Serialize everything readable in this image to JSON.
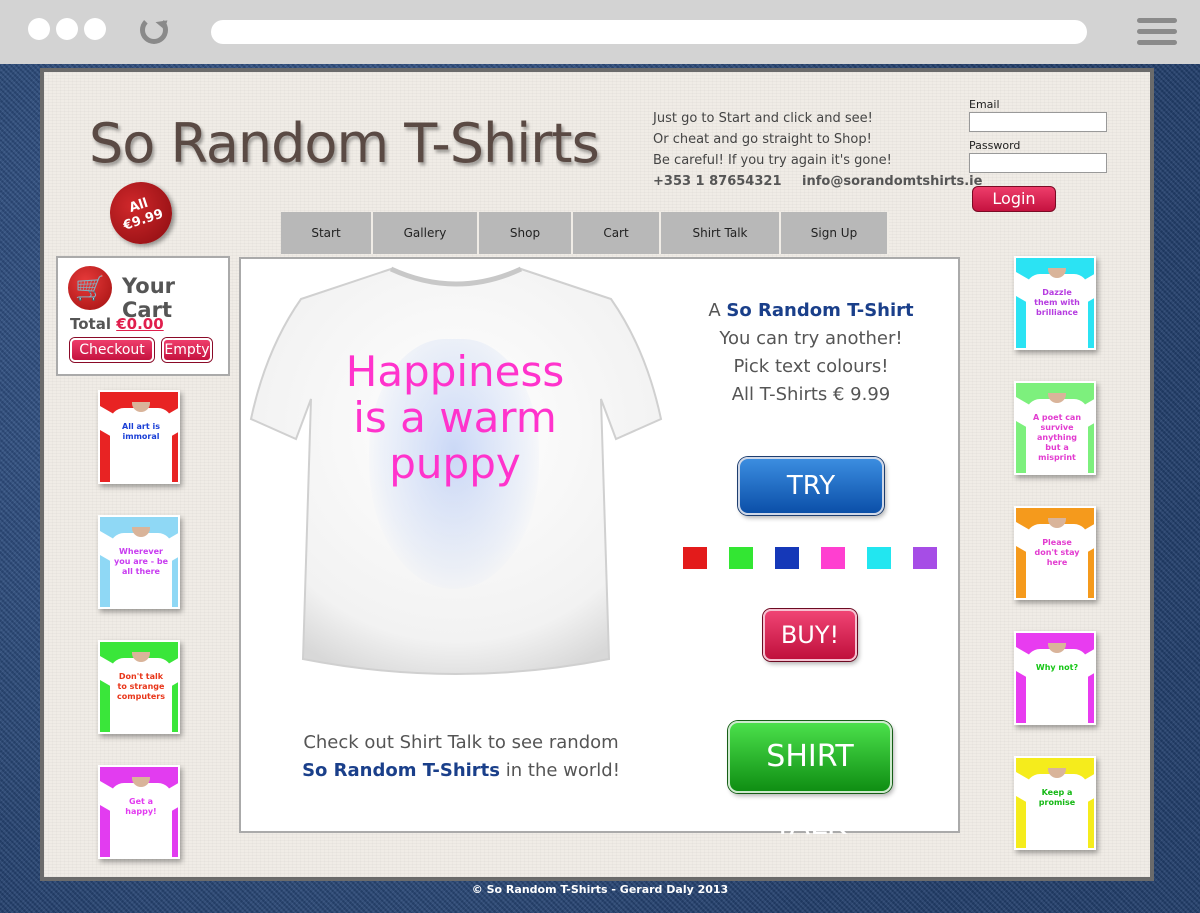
{
  "site": {
    "logo": "So Random T-Shirts",
    "seal_line1": "All",
    "seal_line2": "€9.99"
  },
  "tagline": {
    "line1": "Just go to Start and click and see!",
    "line2": "Or cheat and go straight to Shop!",
    "line3": "Be careful! If you try again it's gone!",
    "phone": "+353 1 87654321",
    "email": "info@sorandomtshirts.ie"
  },
  "login": {
    "email_label": "Email",
    "password_label": "Password",
    "email_value": "",
    "password_value": "",
    "button": "Login"
  },
  "nav": {
    "tabs": [
      {
        "label": "Start"
      },
      {
        "label": "Gallery"
      },
      {
        "label": "Shop"
      },
      {
        "label": "Cart"
      },
      {
        "label": "Shirt Talk"
      },
      {
        "label": "Sign Up"
      }
    ]
  },
  "cart": {
    "icon": "shopping-cart-icon",
    "title": "Your Cart",
    "total_label": "Total",
    "total_value": "€0.00",
    "checkout": "Checkout",
    "empty": "Empty"
  },
  "main": {
    "shirt_text_line1": "Happiness",
    "shirt_text_line2": "is a warm",
    "shirt_text_line3": "puppy",
    "shirt_text_color": "#ff33cc",
    "promo_prefix": "A",
    "promo_brand": "So Random T-Shirt",
    "promo_line2": "You can try another!",
    "promo_line3": "Pick text colours!",
    "promo_line4": "All T-Shirts € 9.99",
    "try_again": "TRY AGAIN!",
    "buy": "BUY!",
    "shirt_talk": "SHIRT TALK",
    "check_line1": "Check out Shirt Talk to see random",
    "check_brand": "So Random T-Shirts",
    "check_suffix": "in the world!",
    "swatches": [
      "#e31b1b",
      "#33e633",
      "#1538b8",
      "#ff3fd0",
      "#22e6f0",
      "#a64de6"
    ]
  },
  "left_thumbs": [
    {
      "slogan": "All art is immoral",
      "bg": "#e82323",
      "text_color": "#1a3fd6"
    },
    {
      "slogan": "Wherever you are - be all there",
      "bg": "#8fd8f5",
      "text_color": "#c83cf0"
    },
    {
      "slogan": "Don't talk to strange computers",
      "bg": "#3ae63a",
      "text_color": "#e8361a"
    },
    {
      "slogan": "Get a happy!",
      "bg": "#e23cf0",
      "text_color": "#e23cf0"
    }
  ],
  "right_thumbs": [
    {
      "slogan": "Dazzle them with brilliance",
      "bg": "#2be3f3",
      "text_color": "#b63ce0"
    },
    {
      "slogan": "A poet can survive anything but a misprint",
      "bg": "#7df07d",
      "text_color": "#e23cd0"
    },
    {
      "slogan": "Please don't stay here",
      "bg": "#f59a1c",
      "text_color": "#e23cd0"
    },
    {
      "slogan": "Why not?",
      "bg": "#e83cf0",
      "text_color": "#16c616"
    },
    {
      "slogan": "Keep a promise",
      "bg": "#f5ec1c",
      "text_color": "#14b814"
    }
  ],
  "footer": "© So Random T-Shirts - Gerard Daly 2013"
}
